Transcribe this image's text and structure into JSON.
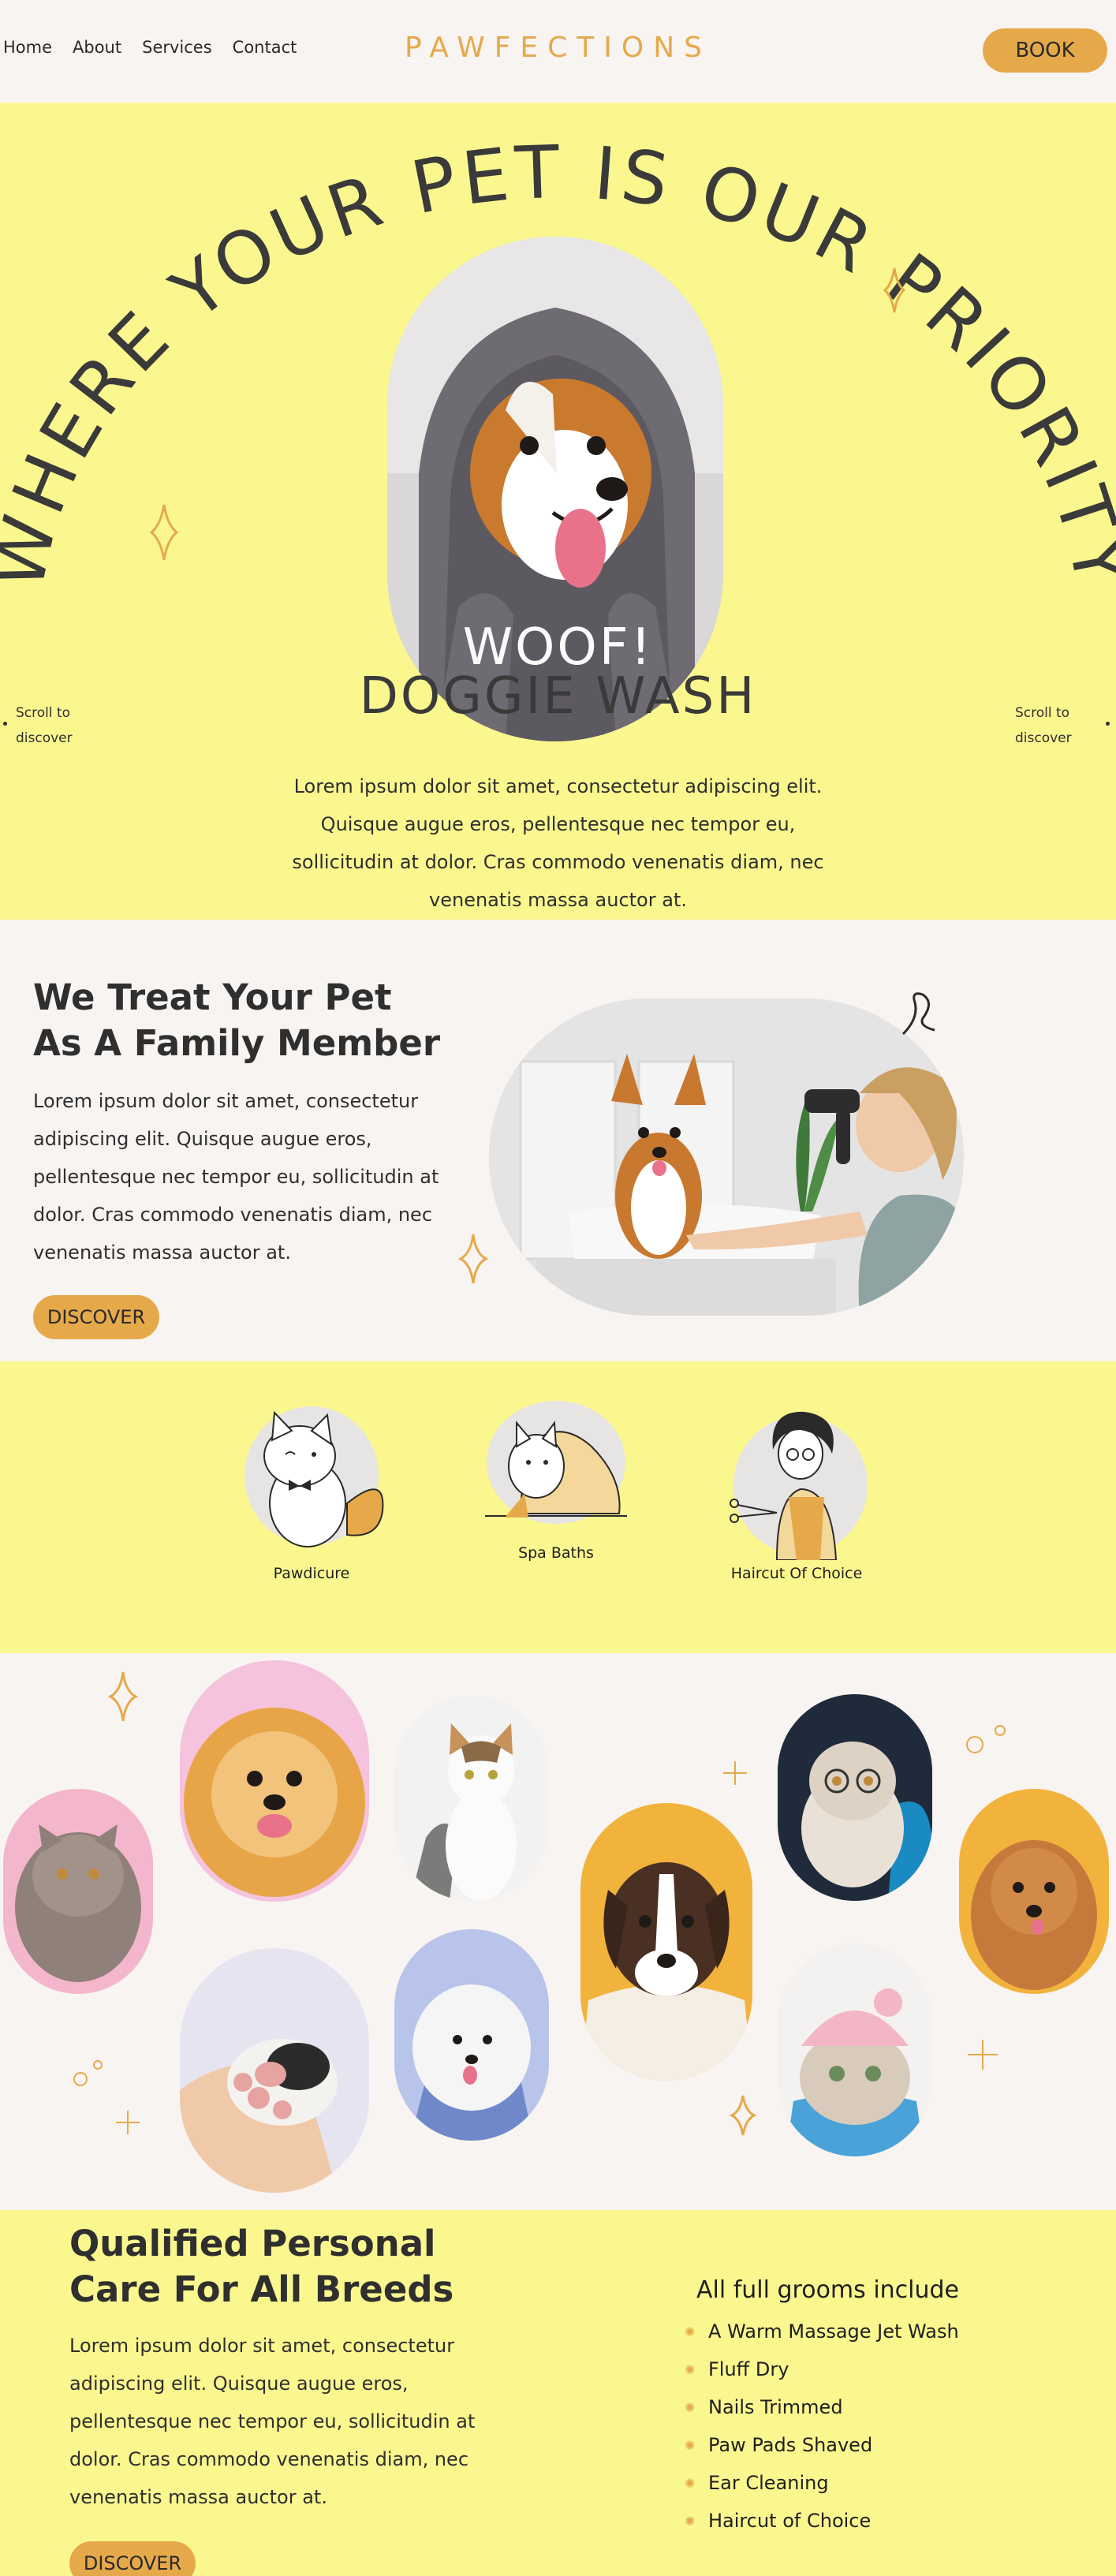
{
  "header": {
    "nav": [
      "Home",
      "About",
      "Services",
      "Contact"
    ],
    "brand": "PAWFECTIONS",
    "book_label": "BOOK"
  },
  "hero": {
    "arc_text": "WHERE YOUR PET IS OUR PRIORITY",
    "title_line1": "WOOF!",
    "title_line2": "DOGGIE WASH",
    "scroll_line1": "Scroll to",
    "scroll_line2": "discover",
    "text": "Lorem ipsum dolor sit amet, consectetur adipiscing elit. Quisque augue eros, pellentesque nec tempor eu, sollicitudin at dolor. Cras commodo venenatis diam, nec venenatis massa auctor at."
  },
  "family": {
    "title_line1": "We Treat Your Pet",
    "title_line2": "As A Family Member",
    "text": "Lorem ipsum dolor sit amet, consectetur adipiscing elit. Quisque augue eros, pellentesque nec tempor eu, sollicitudin at dolor. Cras commodo venenatis diam, nec venenatis massa auctor at.",
    "button": "DISCOVER"
  },
  "services": [
    {
      "label": "Pawdicure",
      "icon": "cat-bowtie-icon"
    },
    {
      "label": "Spa Baths",
      "icon": "cat-towel-icon"
    },
    {
      "label": "Haircut Of Choice",
      "icon": "groomer-scissors-icon"
    }
  ],
  "breeds": {
    "title_line1": "Qualified Personal",
    "title_line2": "Care For All Breeds",
    "text": "Lorem ipsum dolor sit amet, consectetur adipiscing elit. Quisque augue eros, pellentesque nec tempor eu, sollicitudin at dolor. Cras commodo venenatis diam, nec venenatis massa auctor at.",
    "button": "DISCOVER",
    "includes_title": "All full grooms include",
    "includes": [
      "A Warm Massage Jet Wash",
      "Fluff Dry",
      "Nails Trimmed",
      "Paw Pads Shaved",
      "Ear Cleaning",
      "Haircut of Choice"
    ]
  },
  "colors": {
    "accent": "#e6a94a",
    "yellow": "#fbf78f",
    "cream": "#f8f4f2",
    "text": "#2f2f2f"
  }
}
